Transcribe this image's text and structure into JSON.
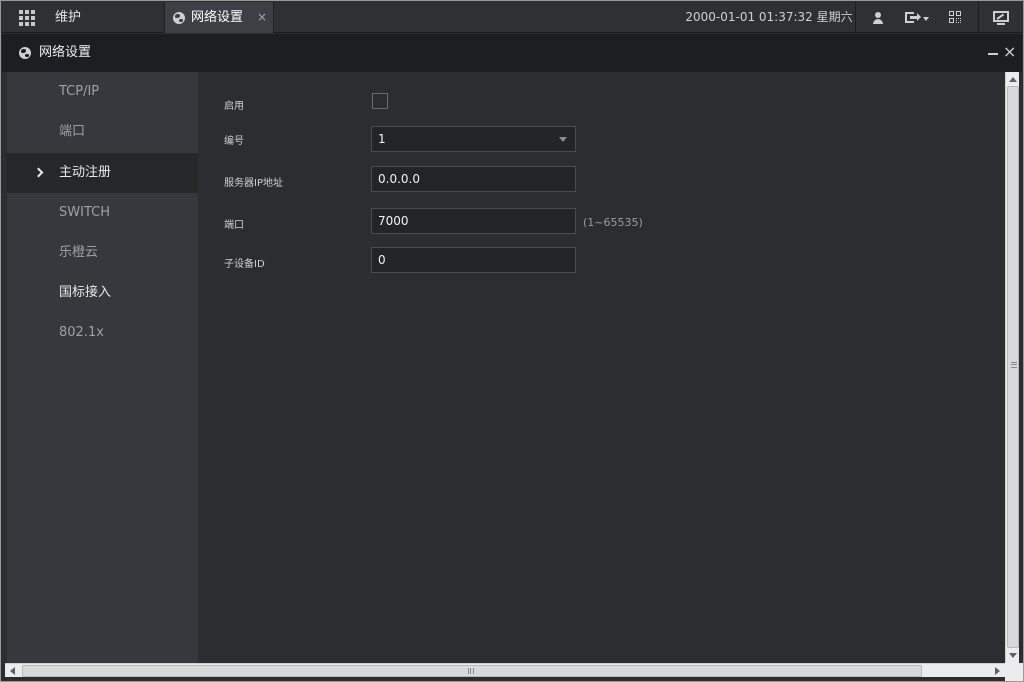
{
  "topbar": {
    "maintenance_tab": "维护",
    "active_tab": "网络设置",
    "active_tab_close": "×",
    "datetime": "2000-01-01 01:37:32 星期六",
    "icons": [
      "grid-menu-icon",
      "user-icon",
      "logout-icon",
      "qr-code-icon",
      "monitor-icon"
    ]
  },
  "window": {
    "title": "网络设置",
    "close": "×"
  },
  "sidebar": {
    "items": [
      {
        "label": "TCP/IP"
      },
      {
        "label": "端口"
      },
      {
        "label": "主动注册"
      },
      {
        "label": "SWITCH"
      },
      {
        "label": "乐橙云"
      },
      {
        "label": "国标接入"
      },
      {
        "label": "802.1x"
      }
    ],
    "active_index": 2
  },
  "form": {
    "enable": {
      "label": "启用",
      "checked": false
    },
    "number": {
      "label": "编号",
      "value": "1"
    },
    "server_ip": {
      "label": "服务器IP地址",
      "value": "0.0.0.0"
    },
    "port": {
      "label": "端口",
      "value": "7000",
      "hint": "(1~65535)"
    },
    "sub_device_id": {
      "label": "子设备ID",
      "value": "0"
    }
  },
  "colors": {
    "background": "#2b2d31",
    "sidebar": "#36383d",
    "sidebar_active": "#262729",
    "titlebar": "#1d1e21"
  }
}
